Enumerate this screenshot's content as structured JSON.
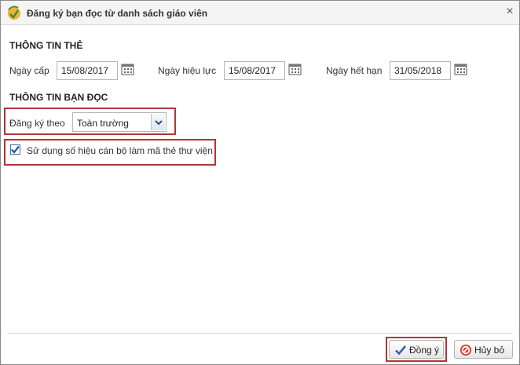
{
  "dialog": {
    "title": "Đăng ký bạn đọc từ danh sách giáo viên"
  },
  "card_info": {
    "section_title": "THÔNG TIN THẺ",
    "issue_date": {
      "label": "Ngày cấp",
      "value": "15/08/2017"
    },
    "effective_date": {
      "label": "Ngày hiệu lực",
      "value": "15/08/2017"
    },
    "expiry_date": {
      "label": "Ngày hết hạn",
      "value": "31/05/2018"
    }
  },
  "reader_info": {
    "section_title": "THÔNG TIN BẠN ĐỌC",
    "register_by": {
      "label": "Đăng ký theo",
      "selected": "Toàn trường"
    },
    "use_staff_id": {
      "label": "Sử dụng số hiệu cán bộ làm mã thẻ thư viện",
      "checked": true
    }
  },
  "footer": {
    "ok_label": "Đồng ý",
    "cancel_label": "Hủy bỏ"
  },
  "colors": {
    "highlight": "#b0343b",
    "check": "#1f4e9a"
  }
}
